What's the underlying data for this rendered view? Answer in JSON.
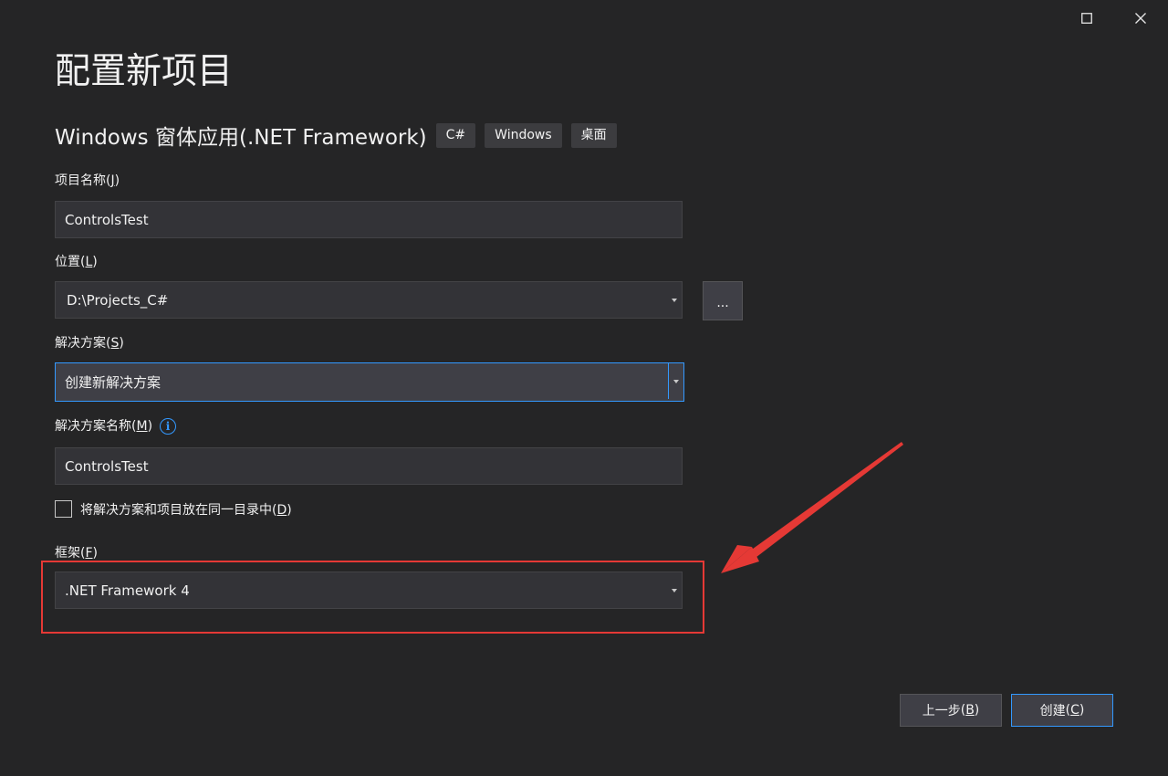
{
  "window": {
    "title": "配置新项目",
    "project_type": "Windows 窗体应用(.NET Framework)",
    "tags": [
      "C#",
      "Windows",
      "桌面"
    ]
  },
  "form": {
    "project_name": {
      "label": "项目名称",
      "mnemonic_open": "(",
      "mnemonic": "J",
      "mnemonic_close": ")",
      "value": "ControlsTest"
    },
    "location": {
      "label": "位置",
      "mnemonic_open": "(",
      "mnemonic": "L",
      "mnemonic_close": ")",
      "value": "D:\\Projects_C#",
      "browse_label": "..."
    },
    "solution": {
      "label": "解决方案",
      "mnemonic_open": "(",
      "mnemonic": "S",
      "mnemonic_close": ")",
      "value": "创建新解决方案"
    },
    "solution_name": {
      "label": "解决方案名称",
      "mnemonic_open": "(",
      "mnemonic": "M",
      "mnemonic_close": ")",
      "value": "ControlsTest",
      "info_glyph": "i"
    },
    "same_dir": {
      "label": "将解决方案和项目放在同一目录中",
      "mnemonic_open": "(",
      "mnemonic": "D",
      "mnemonic_close": ")",
      "checked": false
    },
    "framework": {
      "label": "框架",
      "mnemonic_open": "(",
      "mnemonic": "F",
      "mnemonic_close": ")",
      "value": ".NET Framework 4"
    }
  },
  "buttons": {
    "back_label": "上一步",
    "back_mnemonic": "B",
    "create_label": "创建",
    "create_mnemonic": "C"
  },
  "colors": {
    "background": "#252526",
    "field": "#333337",
    "accent": "#3399ff",
    "annotation": "#e53935"
  },
  "icons": {
    "maximize": "maximize-icon",
    "close": "close-icon",
    "info": "info-icon",
    "dropdown": "chevron-down-icon"
  }
}
